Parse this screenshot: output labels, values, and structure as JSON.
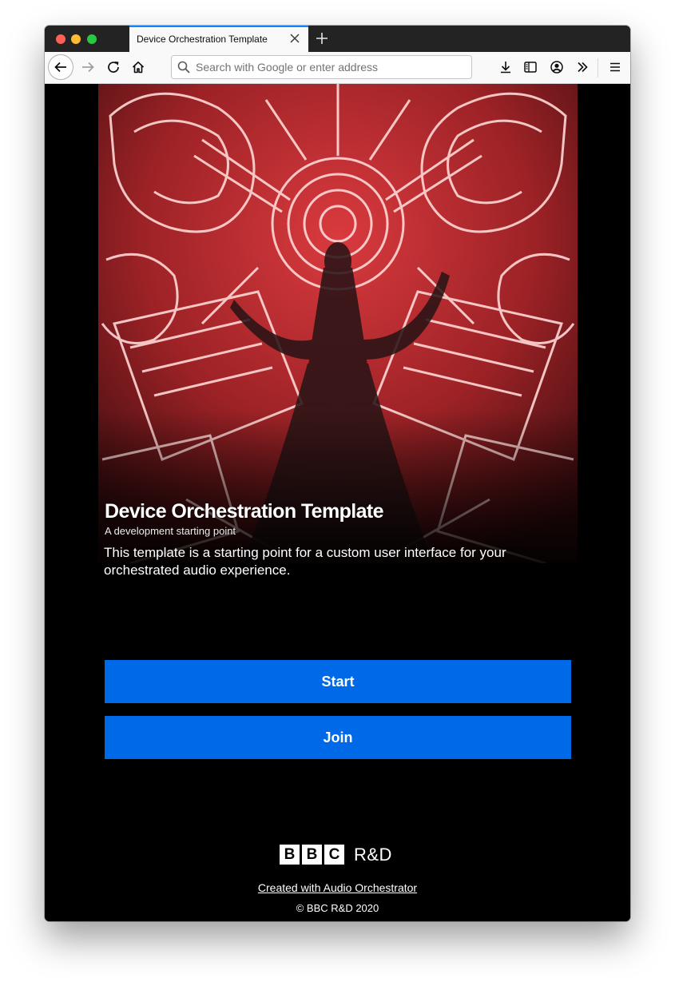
{
  "browser": {
    "tab_title": "Device Orchestration Template",
    "search_placeholder": "Search with Google or enter address",
    "icons": [
      "back-icon",
      "forward-icon",
      "reload-icon",
      "home-icon",
      "search-icon",
      "downloads-icon",
      "sidebar-icon",
      "account-icon",
      "overflow-icon",
      "menu-icon",
      "close-icon",
      "plus-icon"
    ],
    "accent_color": "#0a84ff"
  },
  "hero": {
    "title": "Device Orchestration Template",
    "subtitle": "A development starting point",
    "description": "This template is a starting point for a custom user interface for your orchestrated audio experience."
  },
  "actions": {
    "start_label": "Start",
    "join_label": "Join",
    "button_color": "#0069e8"
  },
  "footer": {
    "logo_letters": [
      "B",
      "B",
      "C"
    ],
    "logo_suffix": "R&D",
    "link_text": "Created with Audio Orchestrator",
    "copyright": "© BBC R&D 2020"
  }
}
